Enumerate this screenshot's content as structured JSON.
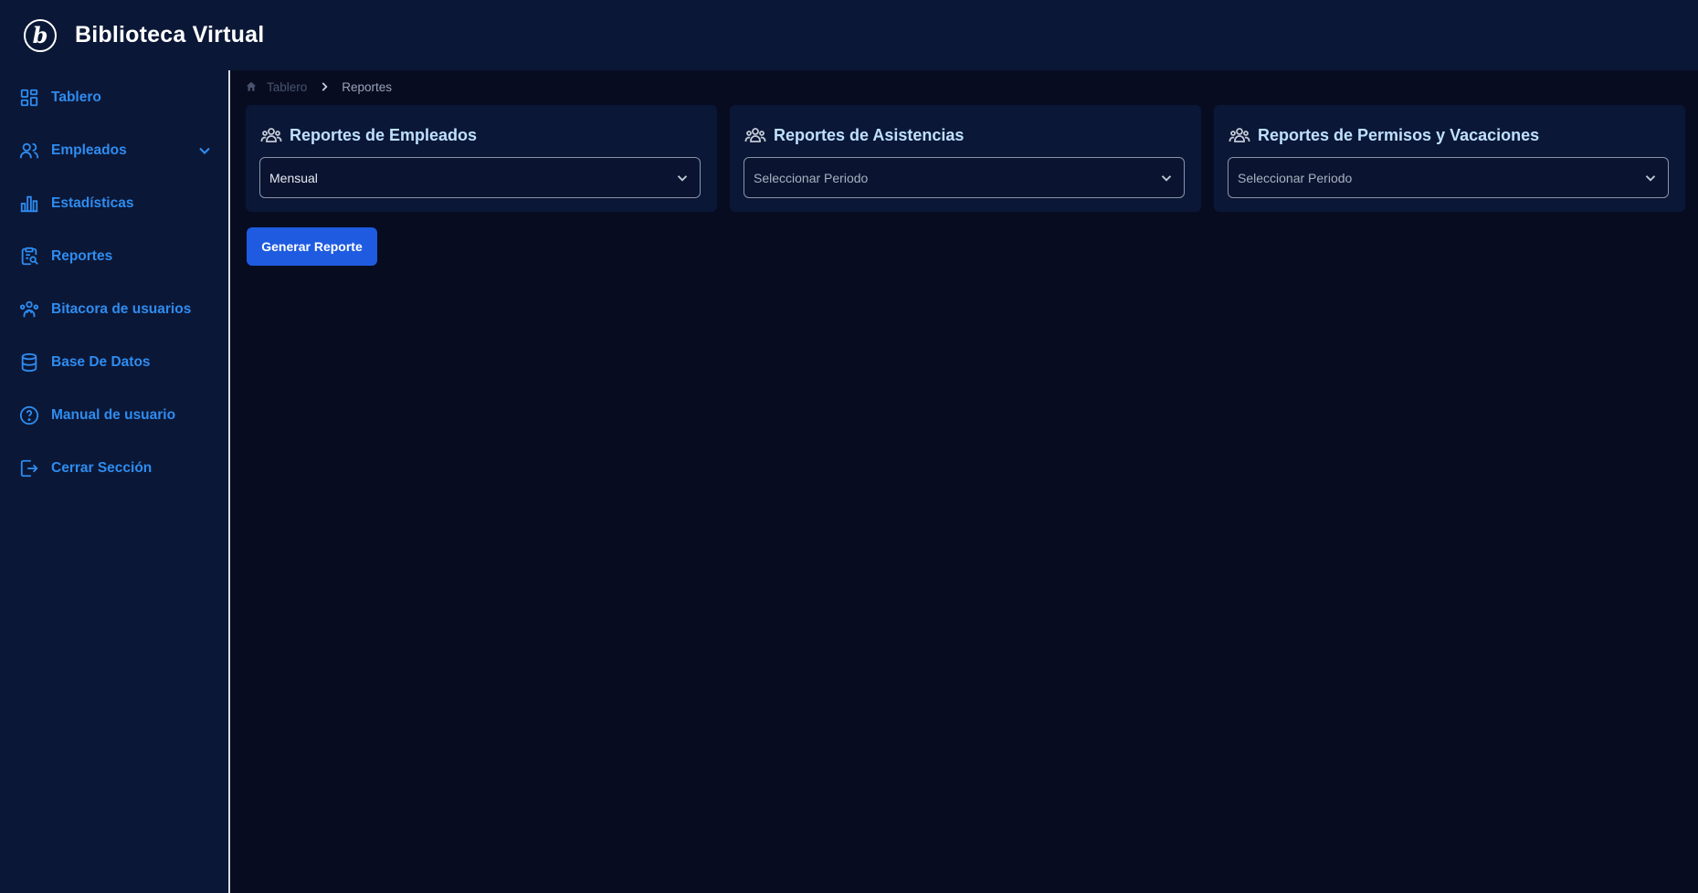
{
  "app": {
    "title": "Biblioteca Virtual"
  },
  "sidebar": {
    "items": [
      {
        "label": "Tablero",
        "icon": "dashboard-icon"
      },
      {
        "label": "Empleados",
        "icon": "users-icon",
        "has_submenu": true
      },
      {
        "label": "Estadísticas",
        "icon": "bar-chart-icon"
      },
      {
        "label": "Reportes",
        "icon": "report-search-icon"
      },
      {
        "label": "Bitacora de usuarios",
        "icon": "user-log-icon"
      },
      {
        "label": "Base De Datos",
        "icon": "database-icon"
      },
      {
        "label": "Manual de usuario",
        "icon": "help-circle-icon"
      },
      {
        "label": "Cerrar Sección",
        "icon": "logout-icon"
      }
    ]
  },
  "breadcrumb": {
    "home": "Tablero",
    "current": "Reportes"
  },
  "cards": [
    {
      "title": "Reportes de Empleados",
      "select_value": "Mensual",
      "is_placeholder": false
    },
    {
      "title": "Reportes de Asistencias",
      "select_value": "Seleccionar Periodo",
      "is_placeholder": true
    },
    {
      "title": "Reportes de Permisos y Vacaciones",
      "select_value": "Seleccionar Periodo",
      "is_placeholder": true
    }
  ],
  "actions": {
    "generate_label": "Generar Reporte"
  },
  "colors": {
    "background": "#070c20",
    "panel": "#0b1736",
    "accent": "#2e8cf0",
    "button": "#1e5be0",
    "card_title": "#bfe0ff"
  }
}
